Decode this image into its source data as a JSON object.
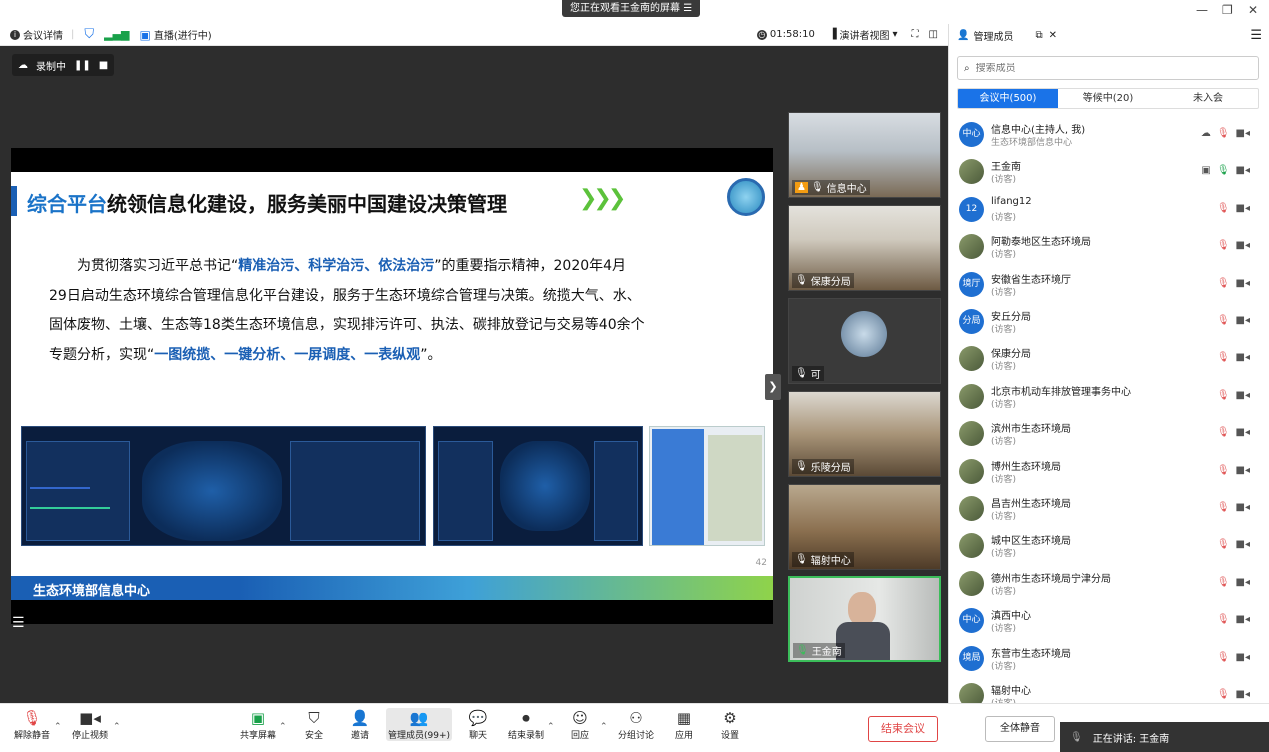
{
  "titlebar": {
    "notice": "您正在观看王金南的屏幕",
    "notice_icon": "share-screen-icon"
  },
  "infobar": {
    "meeting_details": "会议详情",
    "live": "直播(进行中)",
    "timer": "01:58:10",
    "view_mode": "演讲者视图",
    "manage_members": "管理成员"
  },
  "stage": {
    "recording_label": "录制中",
    "slide": {
      "title_highlight": "综合平台",
      "title_rest": "统领信息化建设，服务美丽中国建设决策管理",
      "para_lines": [
        [
          "为贯彻落实习近平总书记“",
          "精准治污、科学治污、依法治污",
          "”的重要指示精神，2020年4月"
        ],
        [
          "29日启动生态环境综合管理信息化平台建设，服务于生态环境综合管理与决策。统揽大气、水、",
          "",
          ""
        ],
        [
          "固体废物、土壤、生态等18类生态环境信息，实现排污许可、执法、碳排放登记与交易等40余个",
          "",
          ""
        ],
        [
          "专题分析，实现“",
          "一图统揽、一键分析、一屏调度、一表纵观",
          "”。"
        ]
      ],
      "footer": "生态环境部信息中心",
      "page_number": "42"
    }
  },
  "gallery": [
    {
      "name": "信息中心",
      "active": false
    },
    {
      "name": "保康分局",
      "active": false
    },
    {
      "name": "可",
      "active": false
    },
    {
      "name": "乐陵分局",
      "active": false
    },
    {
      "name": "辐射中心",
      "active": false
    },
    {
      "name": "王金南",
      "active": true
    }
  ],
  "members_panel": {
    "header": "管理成员",
    "search_placeholder": "搜索成员",
    "tabs": [
      {
        "label": "会议中(500)",
        "active": true
      },
      {
        "label": "等候中(20)",
        "active": false
      },
      {
        "label": "未入会",
        "active": false
      }
    ],
    "members": [
      {
        "avatar": "中心",
        "name": "信息中心(主持人, 我)",
        "sub": "生态环境部信息中心",
        "img": false
      },
      {
        "avatar": "",
        "name": "王金南",
        "sub": "(访客)",
        "img": true
      },
      {
        "avatar": "12",
        "name": "lifang12",
        "sub": "(访客)",
        "img": false
      },
      {
        "avatar": "",
        "name": "阿勒泰地区生态环境局",
        "sub": "(访客)",
        "img": true
      },
      {
        "avatar": "境厅",
        "name": "安徽省生态环境厅",
        "sub": "(访客)",
        "img": false
      },
      {
        "avatar": "分局",
        "name": "安丘分局",
        "sub": "(访客)",
        "img": false
      },
      {
        "avatar": "",
        "name": "保康分局",
        "sub": "(访客)",
        "img": true
      },
      {
        "avatar": "",
        "name": "北京市机动车排放管理事务中心",
        "sub": "(访客)",
        "img": true
      },
      {
        "avatar": "",
        "name": "滨州市生态环境局",
        "sub": "(访客)",
        "img": true
      },
      {
        "avatar": "",
        "name": "博州生态环境局",
        "sub": "(访客)",
        "img": true
      },
      {
        "avatar": "",
        "name": "昌吉州生态环境局",
        "sub": "(访客)",
        "img": true
      },
      {
        "avatar": "",
        "name": "城中区生态环境局",
        "sub": "(访客)",
        "img": true
      },
      {
        "avatar": "",
        "name": "德州市生态环境局宁津分局",
        "sub": "(访客)",
        "img": true
      },
      {
        "avatar": "中心",
        "name": "滇西中心",
        "sub": "(访客)",
        "img": false
      },
      {
        "avatar": "境局",
        "name": "东营市生态环境局",
        "sub": "(访客)",
        "img": false
      },
      {
        "avatar": "",
        "name": "辐射中心",
        "sub": "(访客)",
        "img": true
      }
    ]
  },
  "toolbar": {
    "unmute": "解除静音",
    "stop_video": "停止视频",
    "share_screen": "共享屏幕",
    "security": "安全",
    "invite": "邀请",
    "manage_members": "管理成员(99+)",
    "chat": "聊天",
    "end_recording": "结束录制",
    "reactions": "回应",
    "breakout": "分组讨论",
    "apps": "应用",
    "settings": "设置",
    "end_meeting": "结束会议",
    "mute_all": "全体静音",
    "speaking": "正在讲话: 王金南"
  },
  "colors": {
    "accent": "#1a73e8",
    "end": "#e04545",
    "active_border": "#3bbd5a"
  }
}
